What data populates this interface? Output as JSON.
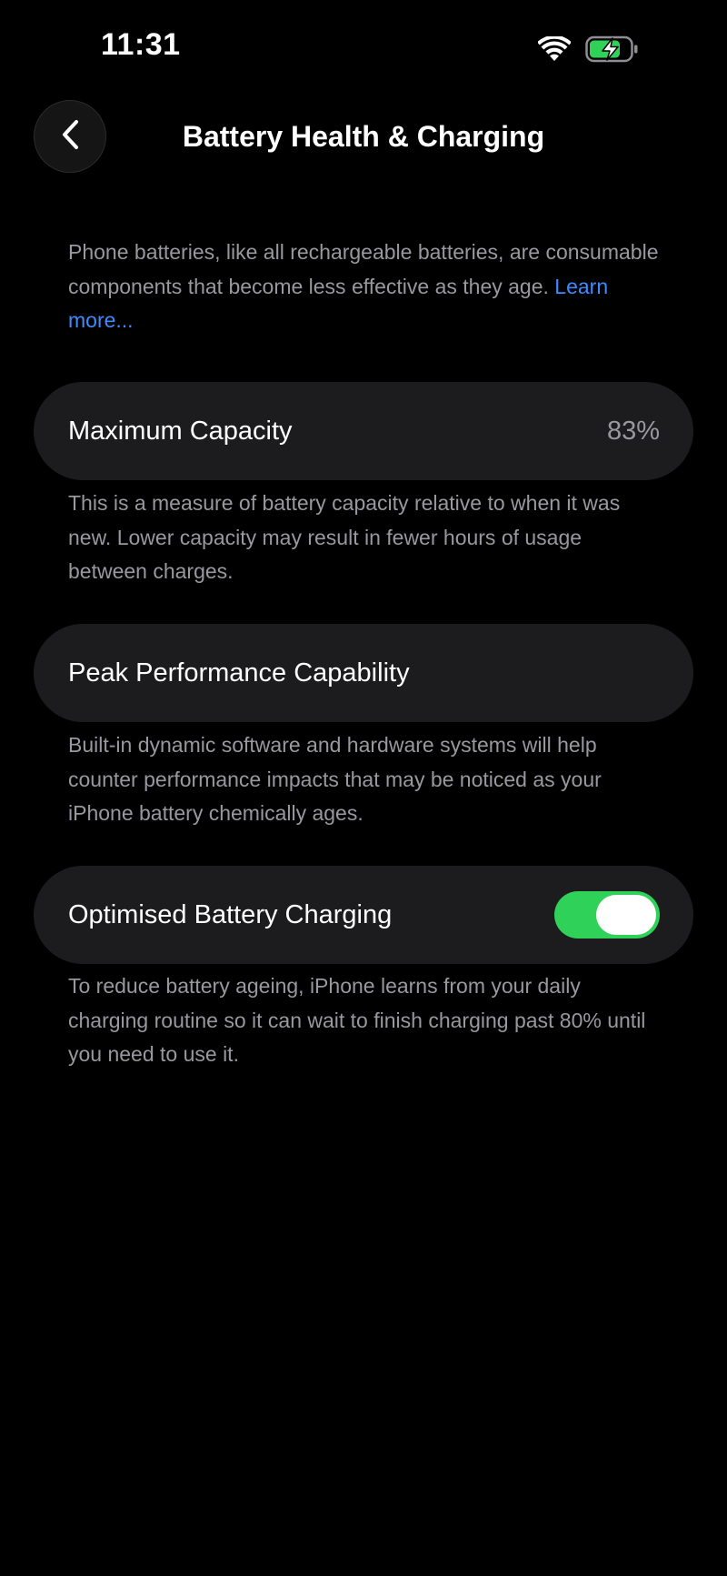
{
  "status_bar": {
    "time": "11:31"
  },
  "nav": {
    "title": "Battery Health & Charging"
  },
  "intro": {
    "text": "Phone batteries, like all rechargeable batteries, are consumable components that become less effective as they age.",
    "link_label": "Learn more..."
  },
  "max_capacity": {
    "label": "Maximum Capacity",
    "value": "83%",
    "footer": "This is a measure of battery capacity relative to when it was new. Lower capacity may result in fewer hours of usage between charges."
  },
  "peak_performance": {
    "label": "Peak Performance Capability",
    "footer": "Built-in dynamic software and hardware systems will help counter performance impacts that may be noticed as your iPhone battery chemically ages."
  },
  "optimised_charging": {
    "label": "Optimised Battery Charging",
    "enabled": true,
    "footer": "To reduce battery ageing, iPhone learns from your daily charging routine so it can wait to finish charging past 80% until you need to use it."
  },
  "colors": {
    "background": "#000000",
    "card": "#1c1c1e",
    "secondary_text": "#98989e",
    "link": "#3d8bfd",
    "toggle_on": "#30d158",
    "battery_charging": "#30d158"
  },
  "icons": {
    "back": "chevron-left-icon",
    "wifi": "wifi-icon",
    "battery": "battery-charging-icon"
  }
}
